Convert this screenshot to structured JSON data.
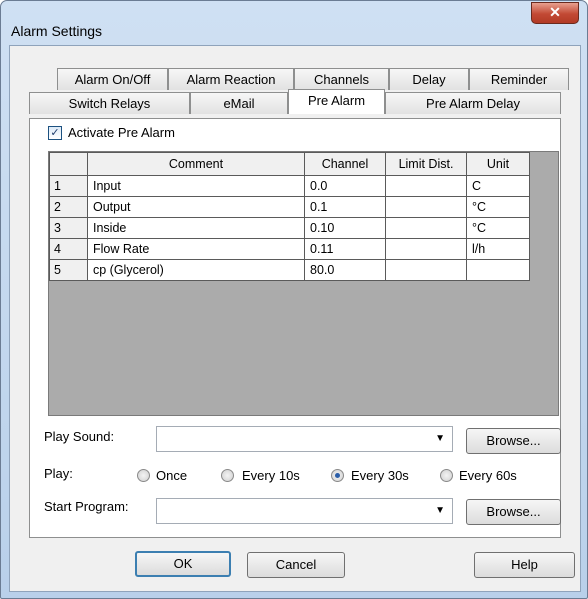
{
  "window": {
    "title": "Alarm Settings",
    "close_glyph": "✕"
  },
  "tabs": {
    "row1": [
      "Alarm On/Off",
      "Alarm Reaction",
      "Channels",
      "Delay",
      "Reminder"
    ],
    "row2": [
      "Switch Relays",
      "eMail",
      "Pre Alarm",
      "Pre Alarm Delay"
    ],
    "active": "Pre Alarm"
  },
  "pre_alarm": {
    "activate_label": "Activate Pre Alarm",
    "activate_checked": true,
    "check_glyph": "✓"
  },
  "grid": {
    "columns": [
      "Comment",
      "Channel",
      "Limit Dist.",
      "Unit"
    ],
    "rows": [
      {
        "num": "1",
        "comment": "Input",
        "channel": "0.0",
        "limit": "",
        "unit": "C"
      },
      {
        "num": "2",
        "comment": "Output",
        "channel": "0.1",
        "limit": "",
        "unit": "°C"
      },
      {
        "num": "3",
        "comment": "Inside",
        "channel": "0.10",
        "limit": "",
        "unit": "°C"
      },
      {
        "num": "4",
        "comment": "Flow Rate",
        "channel": "0.11",
        "limit": "",
        "unit": "l/h"
      },
      {
        "num": "5",
        "comment": "cp (Glycerol)",
        "channel": "80.0",
        "limit": "",
        "unit": ""
      }
    ]
  },
  "play_sound": {
    "label": "Play Sound:",
    "value": "",
    "browse_label": "Browse...",
    "arrow_glyph": "▼"
  },
  "play": {
    "label": "Play:",
    "options": [
      "Once",
      "Every 10s",
      "Every 30s",
      "Every 60s"
    ],
    "selected": "Every 30s"
  },
  "start_program": {
    "label": "Start Program:",
    "value": "",
    "browse_label": "Browse...",
    "arrow_glyph": "▼"
  },
  "buttons": {
    "ok": "OK",
    "cancel": "Cancel",
    "help": "Help"
  }
}
